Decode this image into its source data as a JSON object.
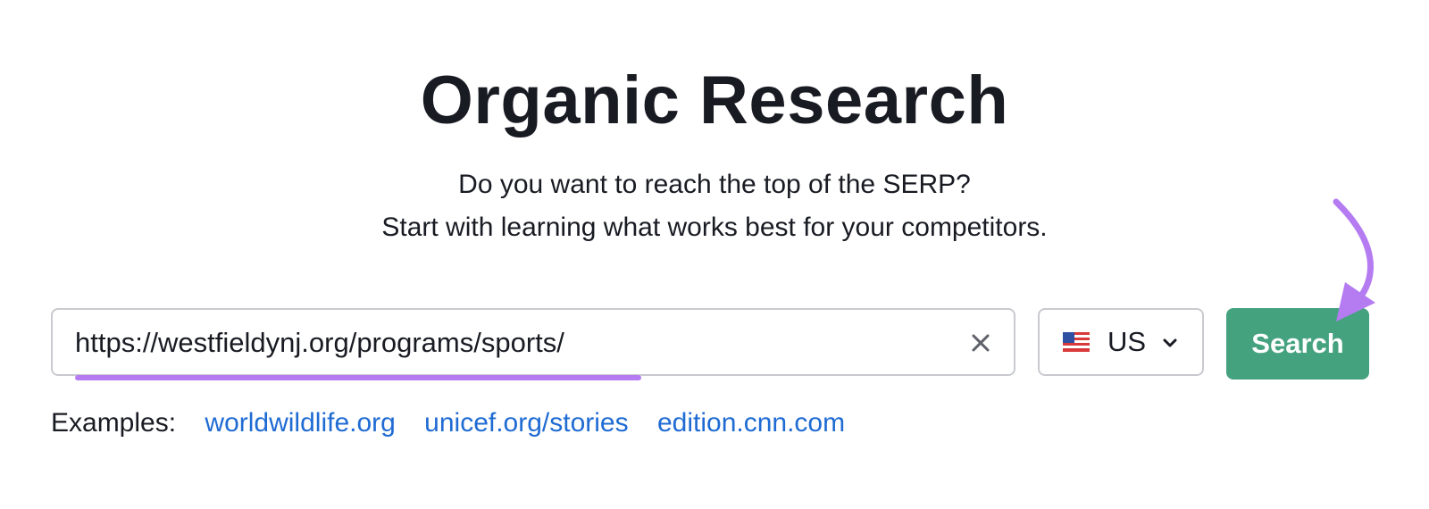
{
  "header": {
    "title": "Organic Research",
    "subtitle_line1": "Do you want to reach the top of the SERP?",
    "subtitle_line2": "Start with learning what works best for your competitors."
  },
  "search": {
    "value": "https://westfieldynj.org/programs/sports/",
    "database": {
      "selected": "US",
      "flag_icon": "us-flag-icon"
    },
    "button_label": "Search"
  },
  "examples": {
    "label": "Examples:",
    "links": [
      "worldwildlife.org",
      "unicef.org/stories",
      "edition.cnn.com"
    ]
  },
  "colors": {
    "button": "#45a27f",
    "link": "#1f6bd3",
    "annotation": "#b57cf2"
  }
}
